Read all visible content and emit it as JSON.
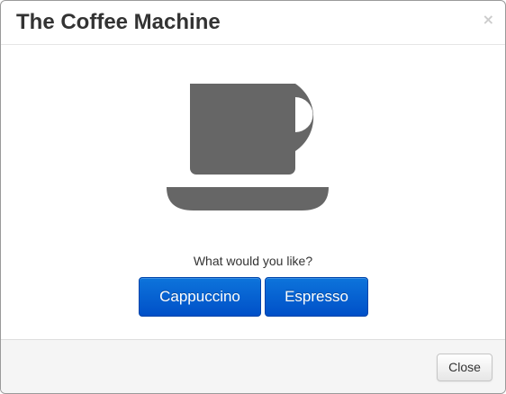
{
  "dialog": {
    "title": "The Coffee Machine",
    "close_icon": "close-icon",
    "close_glyph": "×"
  },
  "body": {
    "illustration_icon": "coffee-cup-icon",
    "illustration_color": "#666666",
    "prompt": "What would you like?",
    "choices": [
      {
        "label": "Cappuccino"
      },
      {
        "label": "Espresso"
      }
    ]
  },
  "footer": {
    "close_label": "Close"
  },
  "colors": {
    "primary_button": "#0060d0",
    "title_text": "#333333",
    "footer_bg": "#f5f5f5"
  }
}
